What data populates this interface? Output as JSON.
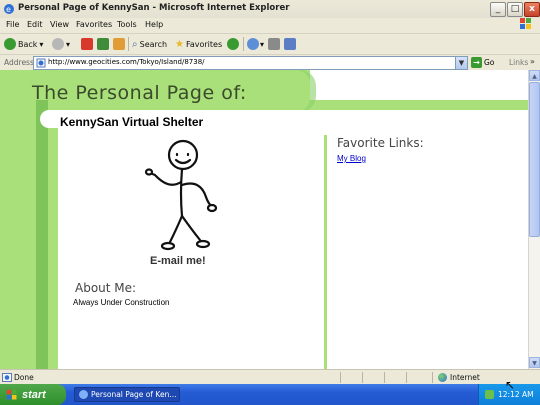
{
  "window": {
    "title": "Personal Page of KennySan - Microsoft Internet Explorer",
    "buttons": {
      "minimize": "_",
      "maximize": "□",
      "close": "x"
    }
  },
  "menu": [
    "File",
    "Edit",
    "View",
    "Favorites",
    "Tools",
    "Help"
  ],
  "toolbar": {
    "back": "Back",
    "search": "Search",
    "favorites": "Favorites"
  },
  "address": {
    "label": "Address",
    "url": "http://www.geocities.com/Tokyo/Island/8738/",
    "go": "Go",
    "links": "Links"
  },
  "page": {
    "heading": "The Personal Page of:",
    "site_title": "KennySan Virtual Shelter",
    "email_label": "E-mail me!",
    "about_title": "About Me:",
    "about_text": "Always Under Construction",
    "favorites_title": "Favorite Links:",
    "favorite_links": [
      "My Blog"
    ],
    "colors": {
      "green_light": "#a9e07a",
      "green_dark": "#7fc45a",
      "link": "#0000cc"
    }
  },
  "status": {
    "text": "Done",
    "zone": "Internet"
  },
  "taskbar": {
    "start": "start",
    "task": "Personal Page of Ken...",
    "clock": "12:12 AM"
  }
}
